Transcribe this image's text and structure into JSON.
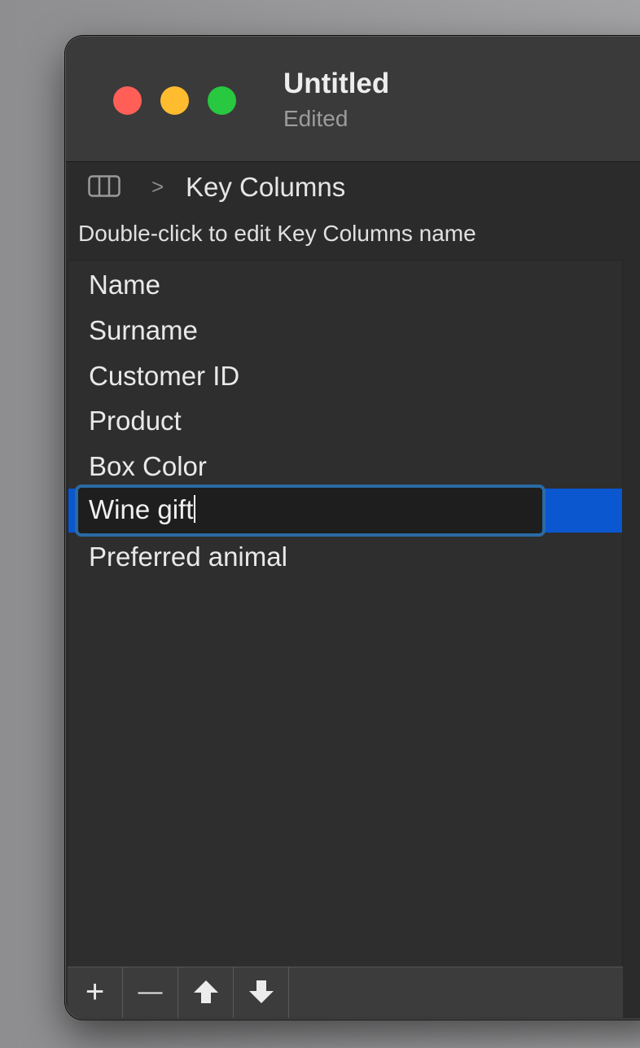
{
  "window": {
    "title": "Untitled",
    "subtitle": "Edited"
  },
  "breadcrumb": {
    "icon": "sidebar-columns-icon",
    "separator": ">",
    "label": "Key Columns"
  },
  "hint": "Double-click to edit Key Columns name",
  "list": {
    "items": [
      "Name",
      "Surname",
      "Customer ID",
      "Product",
      "Box Color",
      "Wine gift",
      "Preferred animal"
    ],
    "selected_index": 5,
    "editing_value": "Wine gift"
  },
  "toolbar": {
    "add": "+",
    "remove": "—",
    "move_up": "arrow-up-icon",
    "move_down": "arrow-down-icon"
  },
  "colors": {
    "window_bg": "#2b2b2b",
    "selection": "#0a57d0",
    "edit_border": "#2b6aa3",
    "close": "#ff5f57",
    "minimize": "#febc2e",
    "zoom": "#28c840"
  }
}
